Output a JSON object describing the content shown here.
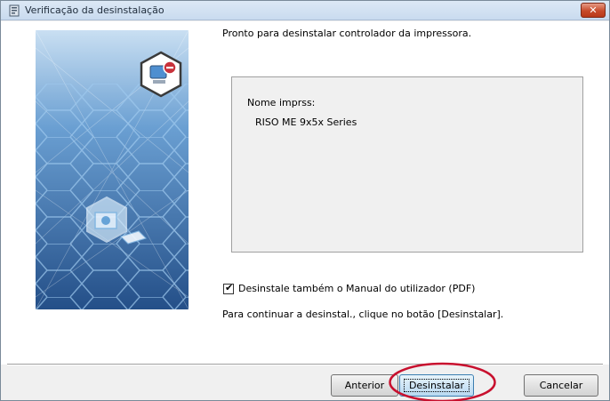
{
  "window": {
    "title": "Verificação da desinstalação",
    "close_label": "✕"
  },
  "main": {
    "message": "Pronto para desinstalar controlador da impressora.",
    "info_box": {
      "label": "Nome imprss:",
      "value": "RISO ME 9x5x Series"
    },
    "checkbox": {
      "label": "Desinstale também o Manual do utilizador (PDF)",
      "checked": true,
      "mark": "✔"
    },
    "instruction": "Para continuar a desinstal., clique no botão [Desinstalar]."
  },
  "footer": {
    "buttons": {
      "previous": "Anterior",
      "uninstall": "Desinstalar",
      "cancel": "Cancelar"
    }
  },
  "colors": {
    "highlight_ring": "#c8102e",
    "art_background": "#2c5f9c",
    "art_lines": "#9ec9ef"
  },
  "icons": {
    "title": "installer-icon",
    "art_top": "computer-remove-icon",
    "art_center": "printer-driver-icon"
  }
}
